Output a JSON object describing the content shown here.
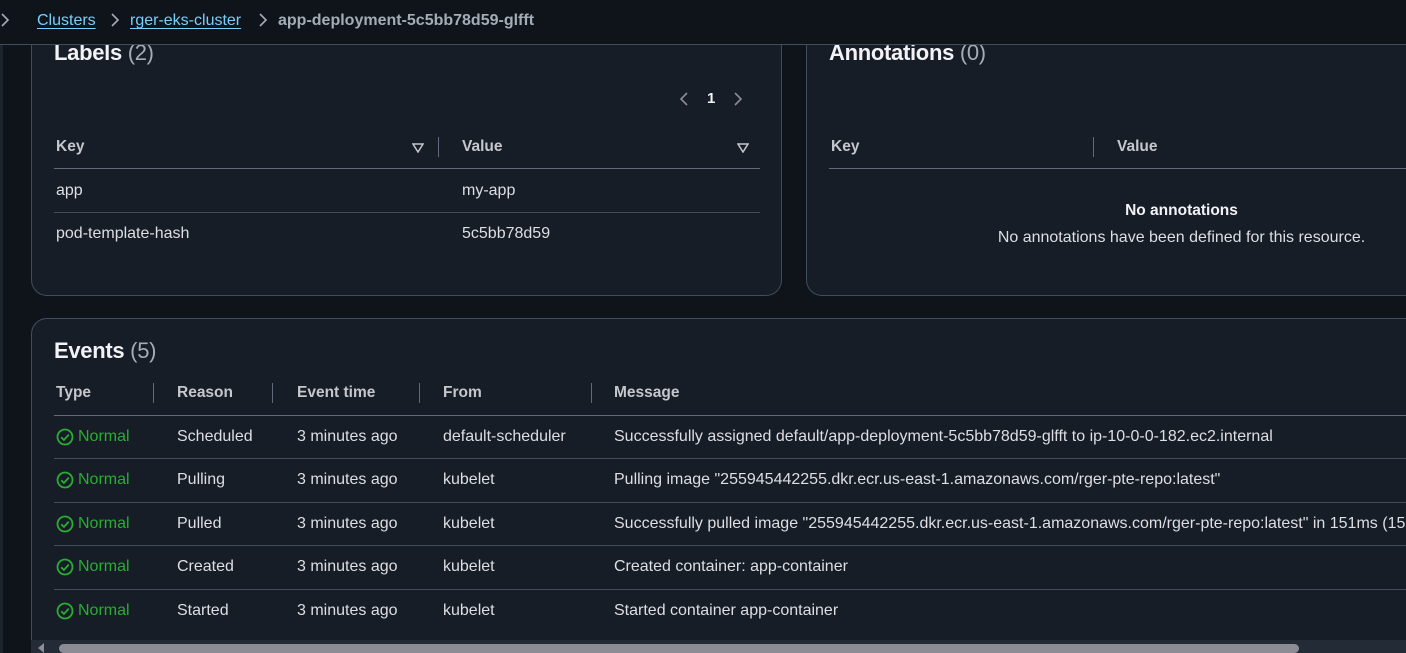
{
  "breadcrumb": {
    "items": [
      {
        "label": "Clusters"
      },
      {
        "label": "rger-eks-cluster"
      },
      {
        "label": "app-deployment-5c5bb78d59-glfft"
      }
    ]
  },
  "labels_panel": {
    "title": "Labels",
    "count": "(2)",
    "pagination": {
      "current_page": "1"
    },
    "columns": [
      "Key",
      "Value"
    ],
    "rows": [
      {
        "key": "app",
        "value": "my-app"
      },
      {
        "key": "pod-template-hash",
        "value": "5c5bb78d59"
      }
    ]
  },
  "annotations_panel": {
    "title": "Annotations",
    "count": "(0)",
    "columns": [
      "Key",
      "Value"
    ],
    "empty_title": "No annotations",
    "empty_message": "No annotations have been defined for this resource."
  },
  "events_panel": {
    "title": "Events",
    "count": "(5)",
    "columns": [
      "Type",
      "Reason",
      "Event time",
      "From",
      "Message"
    ],
    "rows": [
      {
        "type": "Normal",
        "reason": "Scheduled",
        "time": "3 minutes ago",
        "from": "default-scheduler",
        "message": "Successfully assigned default/app-deployment-5c5bb78d59-glfft to ip-10-0-0-182.ec2.internal"
      },
      {
        "type": "Normal",
        "reason": "Pulling",
        "time": "3 minutes ago",
        "from": "kubelet",
        "message": "Pulling image \"255945442255.dkr.ecr.us-east-1.amazonaws.com/rger-pte-repo:latest\""
      },
      {
        "type": "Normal",
        "reason": "Pulled",
        "time": "3 minutes ago",
        "from": "kubelet",
        "message": "Successfully pulled image \"255945442255.dkr.ecr.us-east-1.amazonaws.com/rger-pte-repo:latest\" in 151ms (15"
      },
      {
        "type": "Normal",
        "reason": "Created",
        "time": "3 minutes ago",
        "from": "kubelet",
        "message": "Created container: app-container"
      },
      {
        "type": "Normal",
        "reason": "Started",
        "time": "3 minutes ago",
        "from": "kubelet",
        "message": "Started container app-container"
      }
    ]
  },
  "colors": {
    "link": "#75cfff",
    "success": "#29ad32",
    "background": "#0f141a",
    "panel": "#161d26"
  },
  "icons": [
    "chevron-right-icon",
    "chevron-left-icon",
    "sort-caret-icon",
    "status-success-icon"
  ]
}
